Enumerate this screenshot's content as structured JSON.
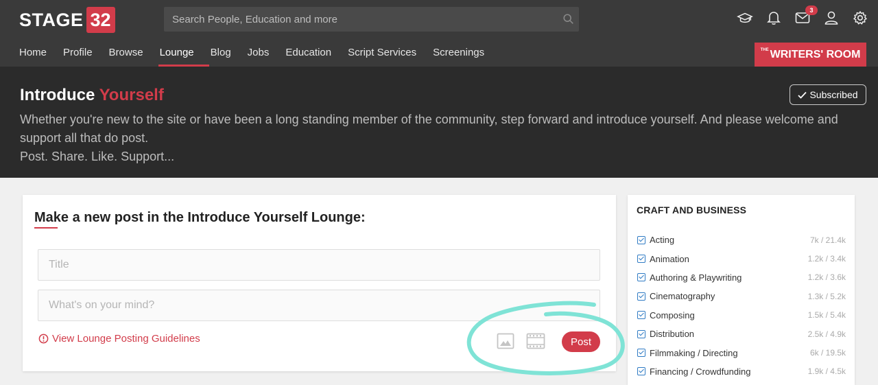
{
  "brand": {
    "logo_text": "STAGE",
    "logo_number": "32"
  },
  "search": {
    "placeholder": "Search People, Education and more"
  },
  "top_icons": {
    "education": "graduation-cap-icon",
    "notifications": "bell-icon",
    "messages": "envelope-icon",
    "messages_badge": "3",
    "profile": "user-icon",
    "settings": "gear-icon"
  },
  "nav": {
    "items": [
      {
        "label": "Home"
      },
      {
        "label": "Profile"
      },
      {
        "label": "Browse"
      },
      {
        "label": "Lounge"
      },
      {
        "label": "Blog"
      },
      {
        "label": "Jobs"
      },
      {
        "label": "Education"
      },
      {
        "label": "Script Services"
      },
      {
        "label": "Screenings"
      }
    ],
    "active": "Lounge"
  },
  "writers_room": {
    "the": "THE",
    "label": "WRITERS' ROOM"
  },
  "hero": {
    "title_main": "Introduce ",
    "title_accent": "Yourself",
    "description": "Whether you're new to the site or have been a long standing member of the community, step forward and introduce yourself. And please welcome and support all that do post.",
    "tagline": "Post. Share. Like. Support...",
    "subscribed_label": "Subscribed"
  },
  "post_form": {
    "heading": "Make a new post in the Introduce Yourself Lounge:",
    "title_placeholder": "Title",
    "body_placeholder": "What's on your mind?",
    "guidelines_link": "View Lounge Posting Guidelines",
    "post_button": "Post"
  },
  "sidebar": {
    "title": "CRAFT AND BUSINESS",
    "items": [
      {
        "name": "Acting",
        "count": "7k / 21.4k"
      },
      {
        "name": "Animation",
        "count": "1.2k / 3.4k"
      },
      {
        "name": "Authoring & Playwriting",
        "count": "1.2k / 3.6k"
      },
      {
        "name": "Cinematography",
        "count": "1.3k / 5.2k"
      },
      {
        "name": "Composing",
        "count": "1.5k / 5.4k"
      },
      {
        "name": "Distribution",
        "count": "2.5k / 4.9k"
      },
      {
        "name": "Filmmaking / Directing",
        "count": "6k / 19.5k"
      },
      {
        "name": "Financing / Crowdfunding",
        "count": "1.9k / 4.5k"
      }
    ]
  },
  "colors": {
    "brand_red": "#d23c4a",
    "topbar": "#3a3a3a",
    "hero": "#2b2b2b",
    "highlight": "#7fe3d6"
  }
}
